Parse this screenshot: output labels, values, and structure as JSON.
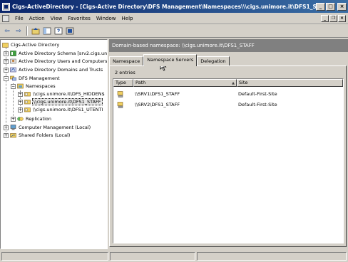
{
  "window": {
    "title": "Cigs-ActiveDirectory - [Cigs-Active Directory\\DFS Management\\Namespaces\\\\\\cigs.unimore.it\\DFS1_STAFF]",
    "minimize_glyph": "_",
    "maximize_glyph": "□",
    "close_glyph": "×"
  },
  "menu": {
    "items": [
      "File",
      "Action",
      "View",
      "Favorites",
      "Window",
      "Help"
    ],
    "mdi_minimize": "_",
    "mdi_restore": "❐",
    "mdi_close": "×"
  },
  "toolbar": {
    "icons": [
      "back-icon",
      "forward-icon",
      "up-level-icon",
      "show-hide-console-tree-icon",
      "help-icon",
      "properties-icon"
    ],
    "back_glyph": "⇦",
    "forward_glyph": "⇨"
  },
  "tree": {
    "nodes": [
      {
        "label": "Cigs-Active Directory",
        "icon": "folder-icon"
      },
      {
        "label": "Active Directory Schema [srv2.cigs.unimore.it]",
        "icon": "schema-icon",
        "expander": "+"
      },
      {
        "label": "Active Directory Users and Computers [srv2.cigs.u",
        "icon": "users-computers-icon",
        "expander": "+"
      },
      {
        "label": "Active Directory Domains and Trusts",
        "icon": "domains-trusts-icon",
        "expander": "+"
      },
      {
        "label": "DFS Management",
        "icon": "dfs-icon",
        "expander": "−"
      },
      {
        "label": "Namespaces",
        "icon": "namespaces-icon",
        "expander": "−"
      },
      {
        "label": "\\\\cigs.unimore.it\\DFS_HIDDEN$",
        "icon": "namespace-icon",
        "expander": "+"
      },
      {
        "label": "\\\\cigs.unimore.it\\DFS1_STAFF",
        "icon": "namespace-icon",
        "expander": "+",
        "selected": true
      },
      {
        "label": "\\\\cigs.unimore.it\\DFS1_UTENTI",
        "icon": "namespace-icon",
        "expander": "+"
      },
      {
        "label": "Replication",
        "icon": "replication-icon",
        "expander": "+"
      },
      {
        "label": "Computer Management (Local)",
        "icon": "computer-management-icon",
        "expander": "+"
      },
      {
        "label": "Shared Folders (Local)",
        "icon": "shared-folders-icon",
        "expander": "+"
      }
    ]
  },
  "details": {
    "header": "Domain-based namespace: \\\\cigs.unimore.it\\DFS1_STAFF",
    "tabs": [
      "Namespace",
      "Namespace Servers",
      "Delegation"
    ],
    "active_tab": "Namespace Servers",
    "entries_text": "2 entries",
    "columns": [
      "Type",
      "Path",
      "Site"
    ],
    "rows": [
      {
        "type_icon": "server-icon",
        "path": "\\\\SRV1\\DFS1_STAFF",
        "site": "Default-First-Site"
      },
      {
        "type_icon": "server-icon",
        "path": "\\\\SRV2\\DFS1_STAFF",
        "site": "Default-First-Site"
      }
    ]
  },
  "colors": {
    "title_bar": "#0a246a",
    "header_band": "#808080",
    "window_face": "#d4d0c8"
  }
}
